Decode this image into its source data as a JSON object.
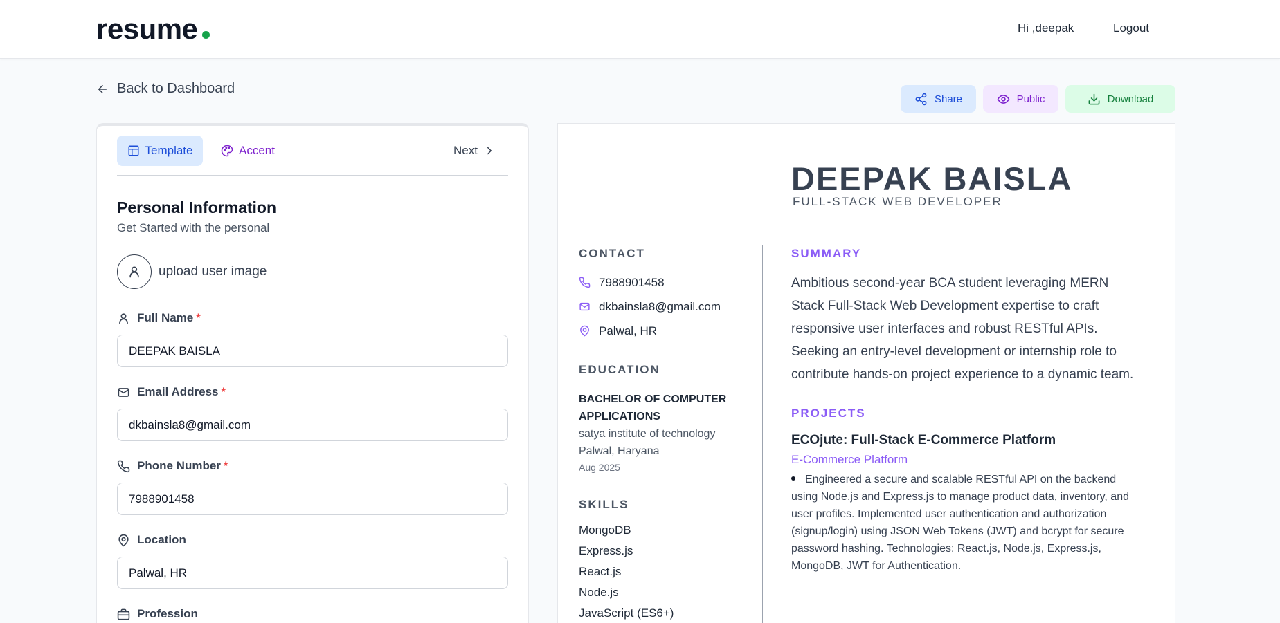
{
  "header": {
    "logo_text": "resume",
    "greeting": "Hi ,deepak",
    "logout_label": "Logout"
  },
  "nav": {
    "back_label": "Back to Dashboard"
  },
  "actions": {
    "share_label": "Share",
    "public_label": "Public",
    "download_label": "Download"
  },
  "editor": {
    "tabs": {
      "template_label": "Template",
      "accent_label": "Accent",
      "next_label": "Next"
    },
    "section_title": "Personal Information",
    "section_subtitle": "Get Started with the personal",
    "upload_label": "upload user image",
    "fields": {
      "full_name": {
        "label": "Full Name",
        "value": "DEEPAK BAISLA",
        "required_mark": "*"
      },
      "email": {
        "label": "Email Address",
        "value": "dkbainsla8@gmail.com",
        "required_mark": "*"
      },
      "phone": {
        "label": "Phone Number",
        "value": "7988901458",
        "required_mark": "*"
      },
      "location": {
        "label": "Location",
        "value": "Palwal, HR"
      },
      "profession": {
        "label": "Profession"
      }
    }
  },
  "resume": {
    "name": "DEEPAK BAISLA",
    "title": "FULL-STACK WEB DEVELOPER",
    "contact": {
      "heading": "CONTACT",
      "phone": "7988901458",
      "email": "dkbainsla8@gmail.com",
      "location": "Palwal, HR"
    },
    "education": {
      "heading": "EDUCATION",
      "degree": "BACHELOR OF COMPUTER APPLICATIONS",
      "institute": "satya institute of technology",
      "place": "Palwal, Haryana",
      "date": "Aug 2025"
    },
    "skills": {
      "heading": "SKILLS",
      "items": [
        "MongoDB",
        "Express.js",
        "React.js",
        "Node.js",
        "JavaScript (ES6+)"
      ]
    },
    "summary": {
      "heading": "SUMMARY",
      "text": "Ambitious second-year BCA student leveraging MERN Stack Full-Stack Web Development expertise to craft responsive user interfaces and robust RESTful APIs. Seeking an entry-level development or internship role to contribute hands-on project experience to a dynamic team."
    },
    "projects": {
      "heading": "PROJECTS",
      "items": [
        {
          "title": "ECOjute: Full-Stack E-Commerce Platform",
          "type": "E-Commerce Platform",
          "description": "Engineered a secure and scalable RESTful API on the backend using Node.js and Express.js to manage product data, inventory, and user profiles. Implemented user authentication and authorization (signup/login) using JSON Web Tokens (JWT) and bcrypt for secure password hashing. Technologies: React.js, Node.js, Express.js, MongoDB, JWT for Authentication."
        }
      ]
    }
  },
  "colors": {
    "accent": "#8b5cf6",
    "brand_dot": "#16a34a",
    "share_bg": "#dbeafe",
    "public_bg": "#f3e8ff",
    "download_bg": "#dcfce7"
  }
}
